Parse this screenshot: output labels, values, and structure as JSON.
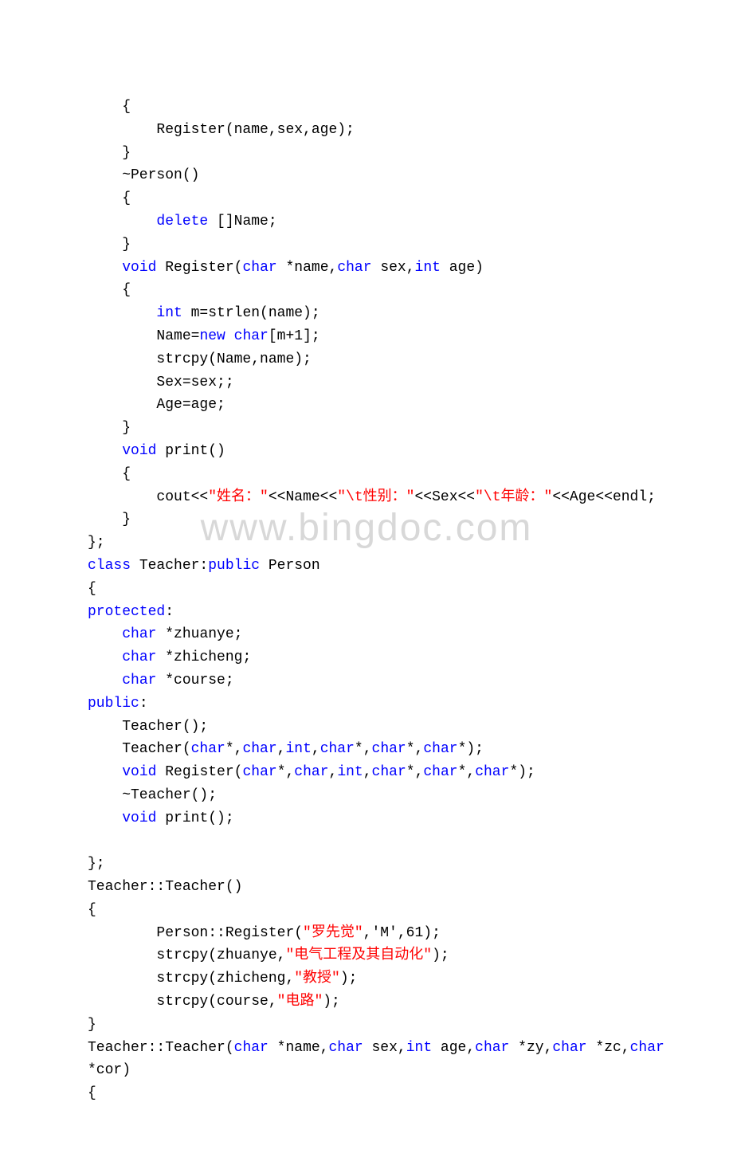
{
  "watermark": "www.bingdoc.com",
  "code": {
    "l1": "    {",
    "l2a": "        Register(name,sex,age);",
    "l3": "    }",
    "l4": "    ~Person()",
    "l5": "    {",
    "l6a": "        ",
    "l6b": "delete",
    "l6c": " []Name;",
    "l7": "    }",
    "l8a": "    ",
    "l8b": "void",
    "l8c": " Register(",
    "l8d": "char",
    "l8e": " *name,",
    "l8f": "char",
    "l8g": " sex,",
    "l8h": "int",
    "l8i": " age)",
    "l9": "    {",
    "l10a": "        ",
    "l10b": "int",
    "l10c": " m=strlen(name);",
    "l11a": "        Name=",
    "l11b": "new",
    "l11c": " ",
    "l11d": "char",
    "l11e": "[m+1];",
    "l12": "        strcpy(Name,name);",
    "l13": "        Sex=sex;;",
    "l14": "        Age=age;",
    "l15": "    }",
    "l16a": "    ",
    "l16b": "void",
    "l16c": " print()",
    "l17": "    {",
    "l18a": "        cout<<",
    "l18b": "\"姓名：\"",
    "l18c": "<<Name<<",
    "l18d": "\"\\t性别：\"",
    "l18e": "<<Sex<<",
    "l18f": "\"\\t年龄：\"",
    "l18g": "<<Age<<endl;",
    "l19": "    }",
    "l20": "};",
    "l21a": "class",
    "l21b": " Teacher:",
    "l21c": "public",
    "l21d": " Person",
    "l22": "{",
    "l23a": "protected",
    "l23b": ":",
    "l24a": "    ",
    "l24b": "char",
    "l24c": " *zhuanye;",
    "l25a": "    ",
    "l25b": "char",
    "l25c": " *zhicheng;",
    "l26a": "    ",
    "l26b": "char",
    "l26c": " *course;",
    "l27a": "public",
    "l27b": ":",
    "l28": "    Teacher();",
    "l29a": "    Teacher(",
    "l29b": "char",
    "l29c": "*,",
    "l29d": "char",
    "l29e": ",",
    "l29f": "int",
    "l29g": ",",
    "l29h": "char",
    "l29i": "*,",
    "l29j": "char",
    "l29k": "*,",
    "l29l": "char",
    "l29m": "*);",
    "l30a": "    ",
    "l30b": "void",
    "l30c": " Register(",
    "l30d": "char",
    "l30e": "*,",
    "l30f": "char",
    "l30g": ",",
    "l30h": "int",
    "l30i": ",",
    "l30j": "char",
    "l30k": "*,",
    "l30l": "char",
    "l30m": "*,",
    "l30n": "char",
    "l30o": "*);",
    "l31": "    ~Teacher();",
    "l32a": "    ",
    "l32b": "void",
    "l32c": " print();",
    "l33": "",
    "l34": "};",
    "l35": "Teacher::Teacher()",
    "l36": "{",
    "l37a": "        Person::Register(",
    "l37b": "\"罗先觉\"",
    "l37c": ",'M',61);",
    "l38a": "        strcpy(zhuanye,",
    "l38b": "\"电气工程及其自动化\"",
    "l38c": ");",
    "l39a": "        strcpy(zhicheng,",
    "l39b": "\"教授\"",
    "l39c": ");",
    "l40a": "        strcpy(course,",
    "l40b": "\"电路\"",
    "l40c": ");",
    "l41": "}",
    "l42a": "Teacher::Teacher(",
    "l42b": "char",
    "l42c": " *name,",
    "l42d": "char",
    "l42e": " sex,",
    "l42f": "int",
    "l42g": " age,",
    "l42h": "char",
    "l42i": " *zy,",
    "l42j": "char",
    "l42k": " *zc,",
    "l42l": "char",
    "l43": "*cor)",
    "l44": "{"
  }
}
